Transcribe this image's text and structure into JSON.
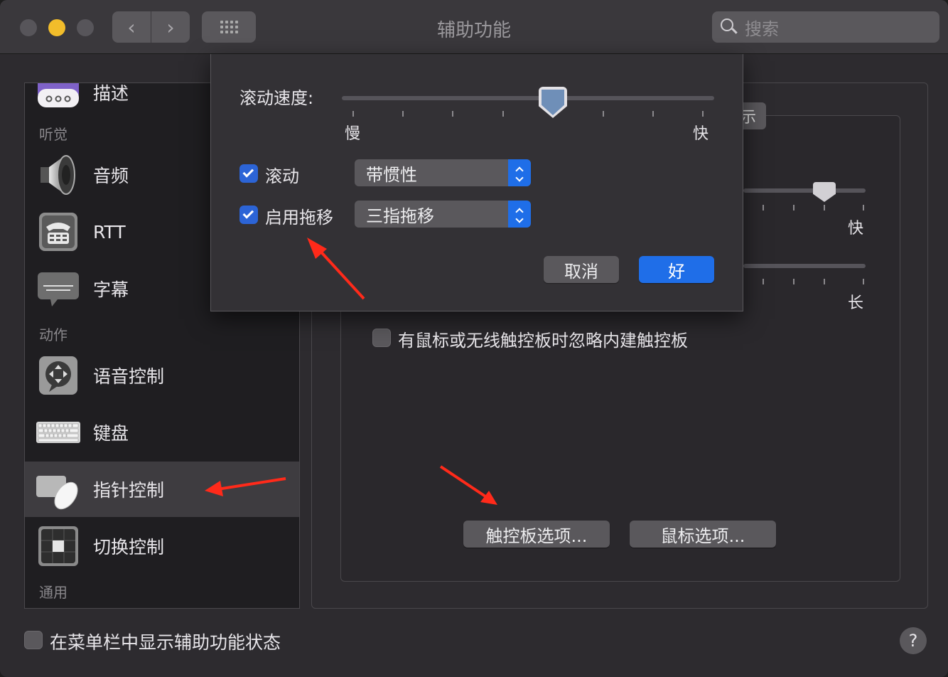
{
  "window": {
    "title": "辅助功能",
    "search_placeholder": "搜索"
  },
  "sidebar": {
    "partial_item": "描述",
    "sections": {
      "hearing": "听觉",
      "motor": "动作",
      "general": "通用"
    },
    "items": [
      {
        "label": "音频",
        "icon": "speaker-icon"
      },
      {
        "label": "RTT",
        "icon": "phone-icon"
      },
      {
        "label": "字幕",
        "icon": "captions-icon"
      },
      {
        "label": "语音控制",
        "icon": "voice-control-icon"
      },
      {
        "label": "键盘",
        "icon": "keyboard-icon"
      },
      {
        "label": "指针控制",
        "icon": "pointer-control-icon",
        "selected": true
      },
      {
        "label": "切换控制",
        "icon": "switch-control-icon"
      }
    ]
  },
  "main": {
    "tab_partial": "示",
    "slider1_right": "快",
    "slider2_right": "长",
    "ignore_trackpad_label": "有鼠标或无线触控板时忽略内建触控板",
    "ignore_trackpad_checked": false,
    "trackpad_options_button": "触控板选项...",
    "mouse_options_button": "鼠标选项..."
  },
  "sheet": {
    "scroll_speed_label": "滚动速度:",
    "scroll_speed_value": 0.55,
    "slow_label": "慢",
    "fast_label": "快",
    "scroll_checkbox_label": "滚动",
    "scroll_checked": true,
    "scroll_mode": "带惯性",
    "drag_checkbox_label": "启用拖移",
    "drag_checked": true,
    "drag_mode": "三指拖移",
    "cancel_button": "取消",
    "ok_button": "好"
  },
  "footer": {
    "menu_status_label": "在菜单栏中显示辅助功能状态",
    "menu_status_checked": false,
    "help_label": "?"
  },
  "colors": {
    "accent": "#1f6ee8",
    "annotation": "#ff2a1a"
  }
}
